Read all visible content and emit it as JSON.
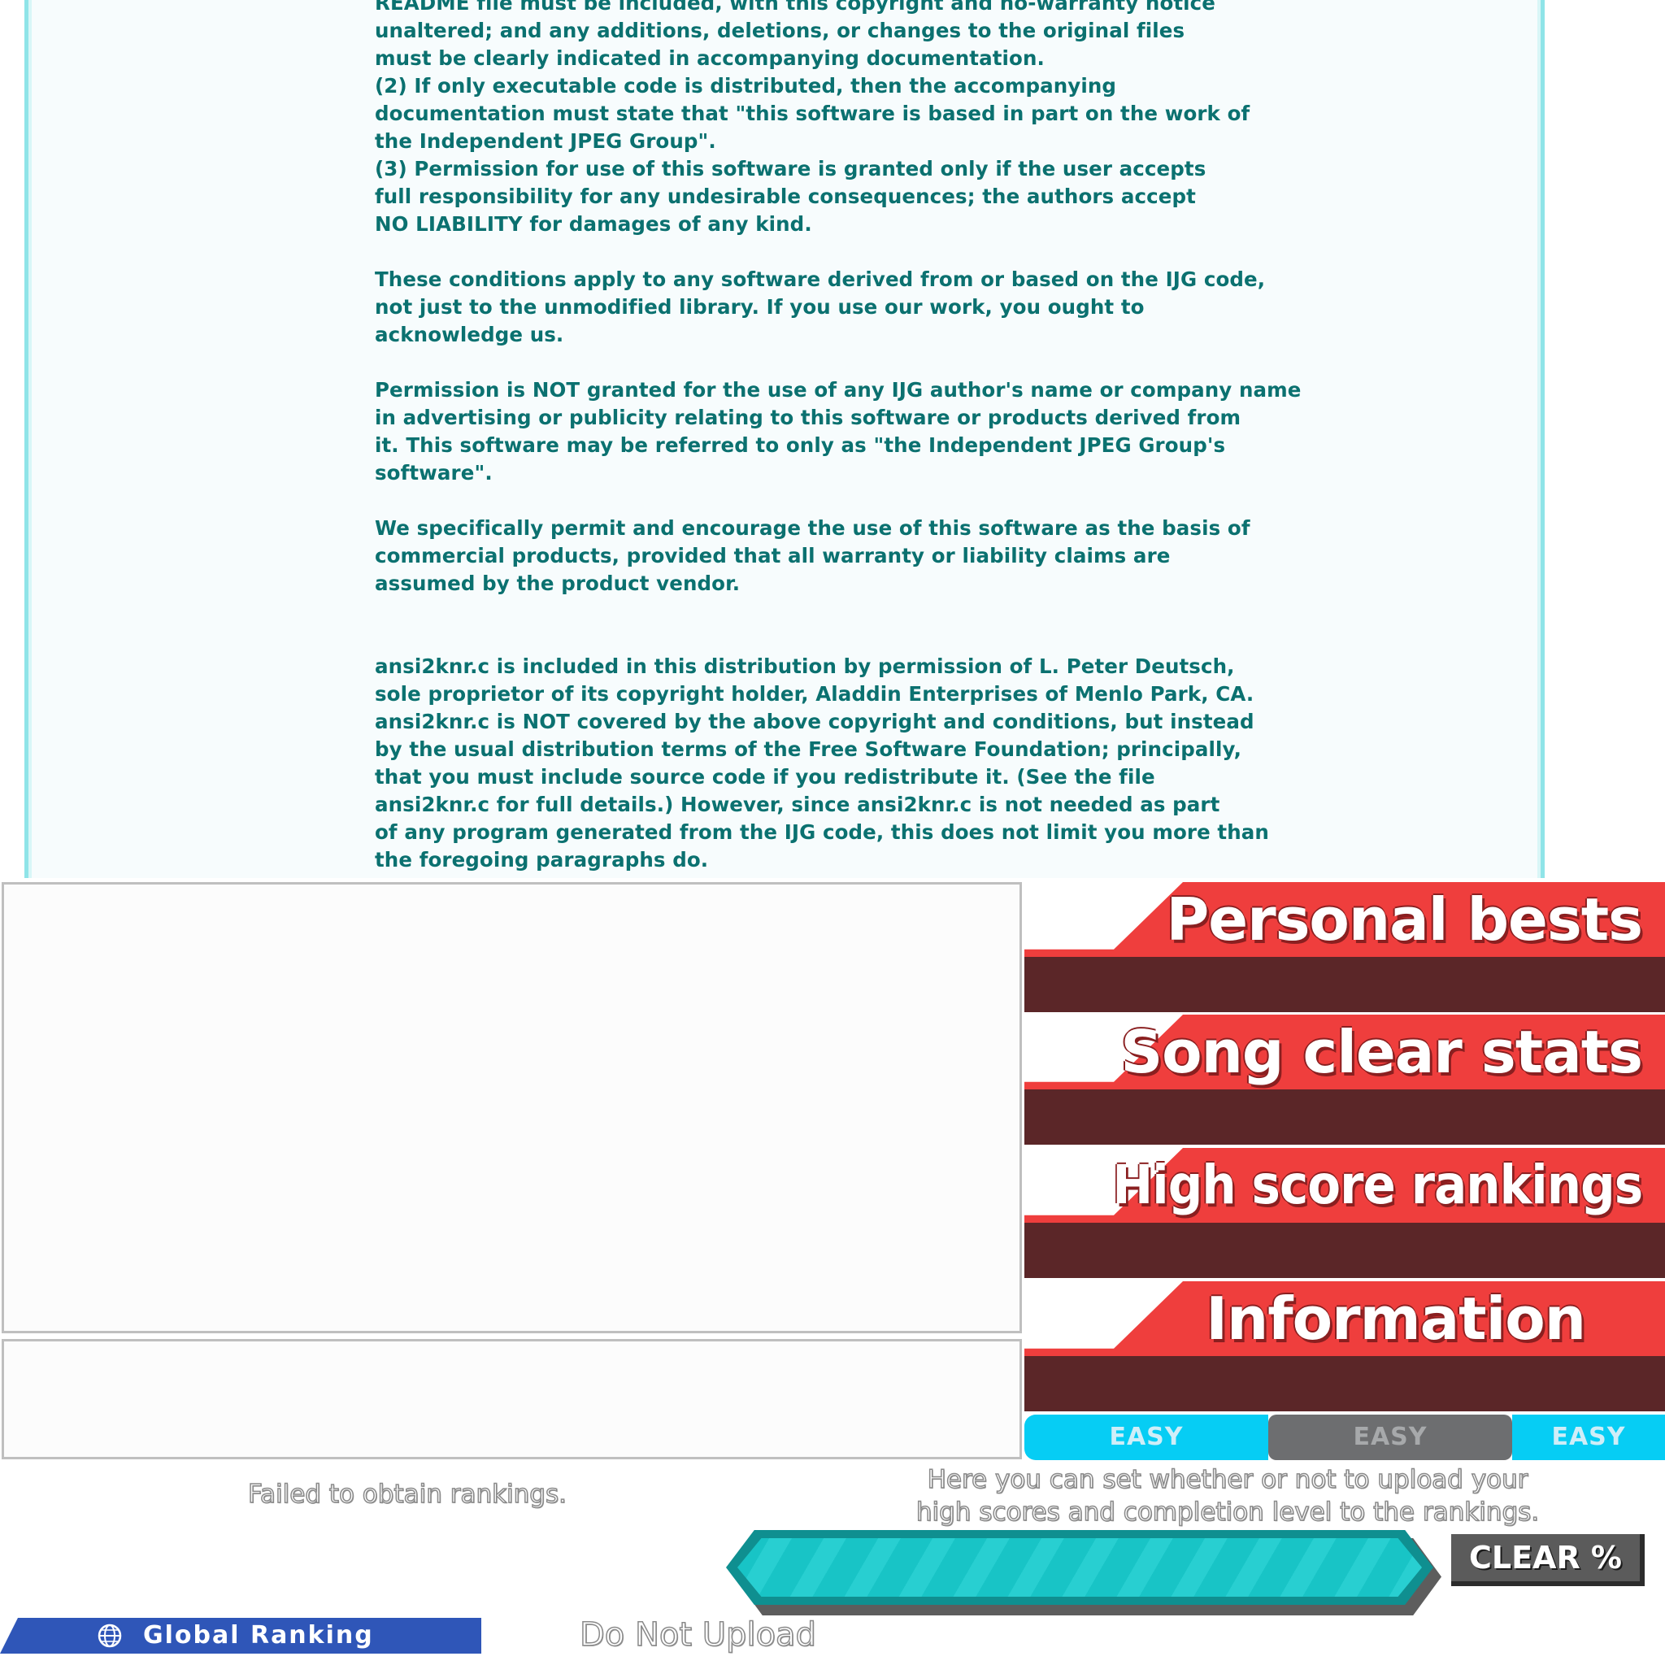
{
  "license": {
    "paragraphs": [
      "README file must be included, with this copyright and no-warranty notice\nunaltered; and any additions, deletions, or changes to the original files\nmust be clearly indicated in accompanying documentation.\n(2) If only executable code is distributed, then the accompanying\ndocumentation must state that \"this software is based in part on the work of\nthe Independent JPEG Group\".\n(3) Permission for use of this software is granted only if the user accepts\nfull responsibility for any undesirable consequences; the authors accept\nNO LIABILITY for damages of any kind.",
      "These conditions apply to any software derived from or based on the IJG code,\nnot just to the unmodified library.  If you use our work, you ought to\nacknowledge us.",
      "Permission is NOT granted for the use of any IJG author's name or company name\nin advertising or publicity relating to this software or products derived from\nit.  This software may be referred to only as \"the Independent JPEG Group's\nsoftware\".",
      "We specifically permit and encourage the use of this software as the basis of\ncommercial products, provided that all warranty or liability claims are\nassumed by the product vendor.",
      "ansi2knr.c is included in this distribution by permission of L. Peter Deutsch,\nsole proprietor of its copyright holder, Aladdin Enterprises of Menlo Park, CA.\nansi2knr.c is NOT covered by the above copyright and conditions, but instead\nby the usual distribution terms of the Free Software Foundation; principally,\nthat you must include source code if you redistribute it.  (See the file\nansi2knr.c for full details.)  However, since ansi2knr.c is not needed as part\nof any program generated from the IJG code, this does not limit you more than\nthe foregoing paragraphs do."
    ]
  },
  "menu": {
    "items": [
      {
        "label": "Personal bests"
      },
      {
        "label": "Song clear stats"
      },
      {
        "label": "High score rankings"
      },
      {
        "label": "Information"
      }
    ]
  },
  "difficulty": {
    "tabs": [
      {
        "label": "EASY",
        "state": "active"
      },
      {
        "label": "EASY",
        "state": "inactive"
      },
      {
        "label": "EASY",
        "state": "active"
      }
    ]
  },
  "rankings": {
    "status": "Failed to obtain rankings.",
    "upload_description": "Here you can set whether or not to upload your\nhigh scores and completion level to the rankings.",
    "upload_option": "Do Not Upload",
    "global_ranking_label": "Global Ranking",
    "clear_badge": "CLEAR %"
  },
  "colors": {
    "license_text": "#0b7170",
    "menu_red": "#ef3e3d",
    "menu_dark": "#5b2628",
    "easy_blue": "#06cdf4",
    "global_blue": "#2f56b8"
  },
  "icons": {
    "global": "globe-icon"
  }
}
